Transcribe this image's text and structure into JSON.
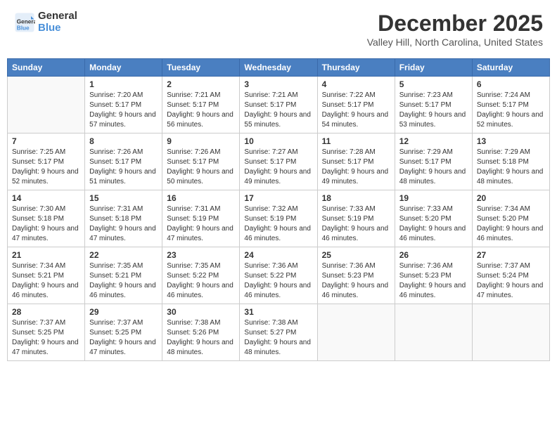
{
  "logo": {
    "general": "General",
    "blue": "Blue"
  },
  "title": "December 2025",
  "location": "Valley Hill, North Carolina, United States",
  "weekdays": [
    "Sunday",
    "Monday",
    "Tuesday",
    "Wednesday",
    "Thursday",
    "Friday",
    "Saturday"
  ],
  "weeks": [
    [
      {
        "num": "",
        "empty": true
      },
      {
        "num": "1",
        "sunrise": "Sunrise: 7:20 AM",
        "sunset": "Sunset: 5:17 PM",
        "daylight": "Daylight: 9 hours and 57 minutes."
      },
      {
        "num": "2",
        "sunrise": "Sunrise: 7:21 AM",
        "sunset": "Sunset: 5:17 PM",
        "daylight": "Daylight: 9 hours and 56 minutes."
      },
      {
        "num": "3",
        "sunrise": "Sunrise: 7:21 AM",
        "sunset": "Sunset: 5:17 PM",
        "daylight": "Daylight: 9 hours and 55 minutes."
      },
      {
        "num": "4",
        "sunrise": "Sunrise: 7:22 AM",
        "sunset": "Sunset: 5:17 PM",
        "daylight": "Daylight: 9 hours and 54 minutes."
      },
      {
        "num": "5",
        "sunrise": "Sunrise: 7:23 AM",
        "sunset": "Sunset: 5:17 PM",
        "daylight": "Daylight: 9 hours and 53 minutes."
      },
      {
        "num": "6",
        "sunrise": "Sunrise: 7:24 AM",
        "sunset": "Sunset: 5:17 PM",
        "daylight": "Daylight: 9 hours and 52 minutes."
      }
    ],
    [
      {
        "num": "7",
        "sunrise": "Sunrise: 7:25 AM",
        "sunset": "Sunset: 5:17 PM",
        "daylight": "Daylight: 9 hours and 52 minutes."
      },
      {
        "num": "8",
        "sunrise": "Sunrise: 7:26 AM",
        "sunset": "Sunset: 5:17 PM",
        "daylight": "Daylight: 9 hours and 51 minutes."
      },
      {
        "num": "9",
        "sunrise": "Sunrise: 7:26 AM",
        "sunset": "Sunset: 5:17 PM",
        "daylight": "Daylight: 9 hours and 50 minutes."
      },
      {
        "num": "10",
        "sunrise": "Sunrise: 7:27 AM",
        "sunset": "Sunset: 5:17 PM",
        "daylight": "Daylight: 9 hours and 49 minutes."
      },
      {
        "num": "11",
        "sunrise": "Sunrise: 7:28 AM",
        "sunset": "Sunset: 5:17 PM",
        "daylight": "Daylight: 9 hours and 49 minutes."
      },
      {
        "num": "12",
        "sunrise": "Sunrise: 7:29 AM",
        "sunset": "Sunset: 5:17 PM",
        "daylight": "Daylight: 9 hours and 48 minutes."
      },
      {
        "num": "13",
        "sunrise": "Sunrise: 7:29 AM",
        "sunset": "Sunset: 5:18 PM",
        "daylight": "Daylight: 9 hours and 48 minutes."
      }
    ],
    [
      {
        "num": "14",
        "sunrise": "Sunrise: 7:30 AM",
        "sunset": "Sunset: 5:18 PM",
        "daylight": "Daylight: 9 hours and 47 minutes."
      },
      {
        "num": "15",
        "sunrise": "Sunrise: 7:31 AM",
        "sunset": "Sunset: 5:18 PM",
        "daylight": "Daylight: 9 hours and 47 minutes."
      },
      {
        "num": "16",
        "sunrise": "Sunrise: 7:31 AM",
        "sunset": "Sunset: 5:19 PM",
        "daylight": "Daylight: 9 hours and 47 minutes."
      },
      {
        "num": "17",
        "sunrise": "Sunrise: 7:32 AM",
        "sunset": "Sunset: 5:19 PM",
        "daylight": "Daylight: 9 hours and 46 minutes."
      },
      {
        "num": "18",
        "sunrise": "Sunrise: 7:33 AM",
        "sunset": "Sunset: 5:19 PM",
        "daylight": "Daylight: 9 hours and 46 minutes."
      },
      {
        "num": "19",
        "sunrise": "Sunrise: 7:33 AM",
        "sunset": "Sunset: 5:20 PM",
        "daylight": "Daylight: 9 hours and 46 minutes."
      },
      {
        "num": "20",
        "sunrise": "Sunrise: 7:34 AM",
        "sunset": "Sunset: 5:20 PM",
        "daylight": "Daylight: 9 hours and 46 minutes."
      }
    ],
    [
      {
        "num": "21",
        "sunrise": "Sunrise: 7:34 AM",
        "sunset": "Sunset: 5:21 PM",
        "daylight": "Daylight: 9 hours and 46 minutes."
      },
      {
        "num": "22",
        "sunrise": "Sunrise: 7:35 AM",
        "sunset": "Sunset: 5:21 PM",
        "daylight": "Daylight: 9 hours and 46 minutes."
      },
      {
        "num": "23",
        "sunrise": "Sunrise: 7:35 AM",
        "sunset": "Sunset: 5:22 PM",
        "daylight": "Daylight: 9 hours and 46 minutes."
      },
      {
        "num": "24",
        "sunrise": "Sunrise: 7:36 AM",
        "sunset": "Sunset: 5:22 PM",
        "daylight": "Daylight: 9 hours and 46 minutes."
      },
      {
        "num": "25",
        "sunrise": "Sunrise: 7:36 AM",
        "sunset": "Sunset: 5:23 PM",
        "daylight": "Daylight: 9 hours and 46 minutes."
      },
      {
        "num": "26",
        "sunrise": "Sunrise: 7:36 AM",
        "sunset": "Sunset: 5:23 PM",
        "daylight": "Daylight: 9 hours and 46 minutes."
      },
      {
        "num": "27",
        "sunrise": "Sunrise: 7:37 AM",
        "sunset": "Sunset: 5:24 PM",
        "daylight": "Daylight: 9 hours and 47 minutes."
      }
    ],
    [
      {
        "num": "28",
        "sunrise": "Sunrise: 7:37 AM",
        "sunset": "Sunset: 5:25 PM",
        "daylight": "Daylight: 9 hours and 47 minutes."
      },
      {
        "num": "29",
        "sunrise": "Sunrise: 7:37 AM",
        "sunset": "Sunset: 5:25 PM",
        "daylight": "Daylight: 9 hours and 47 minutes."
      },
      {
        "num": "30",
        "sunrise": "Sunrise: 7:38 AM",
        "sunset": "Sunset: 5:26 PM",
        "daylight": "Daylight: 9 hours and 48 minutes."
      },
      {
        "num": "31",
        "sunrise": "Sunrise: 7:38 AM",
        "sunset": "Sunset: 5:27 PM",
        "daylight": "Daylight: 9 hours and 48 minutes."
      },
      {
        "num": "",
        "empty": true
      },
      {
        "num": "",
        "empty": true
      },
      {
        "num": "",
        "empty": true
      }
    ]
  ]
}
